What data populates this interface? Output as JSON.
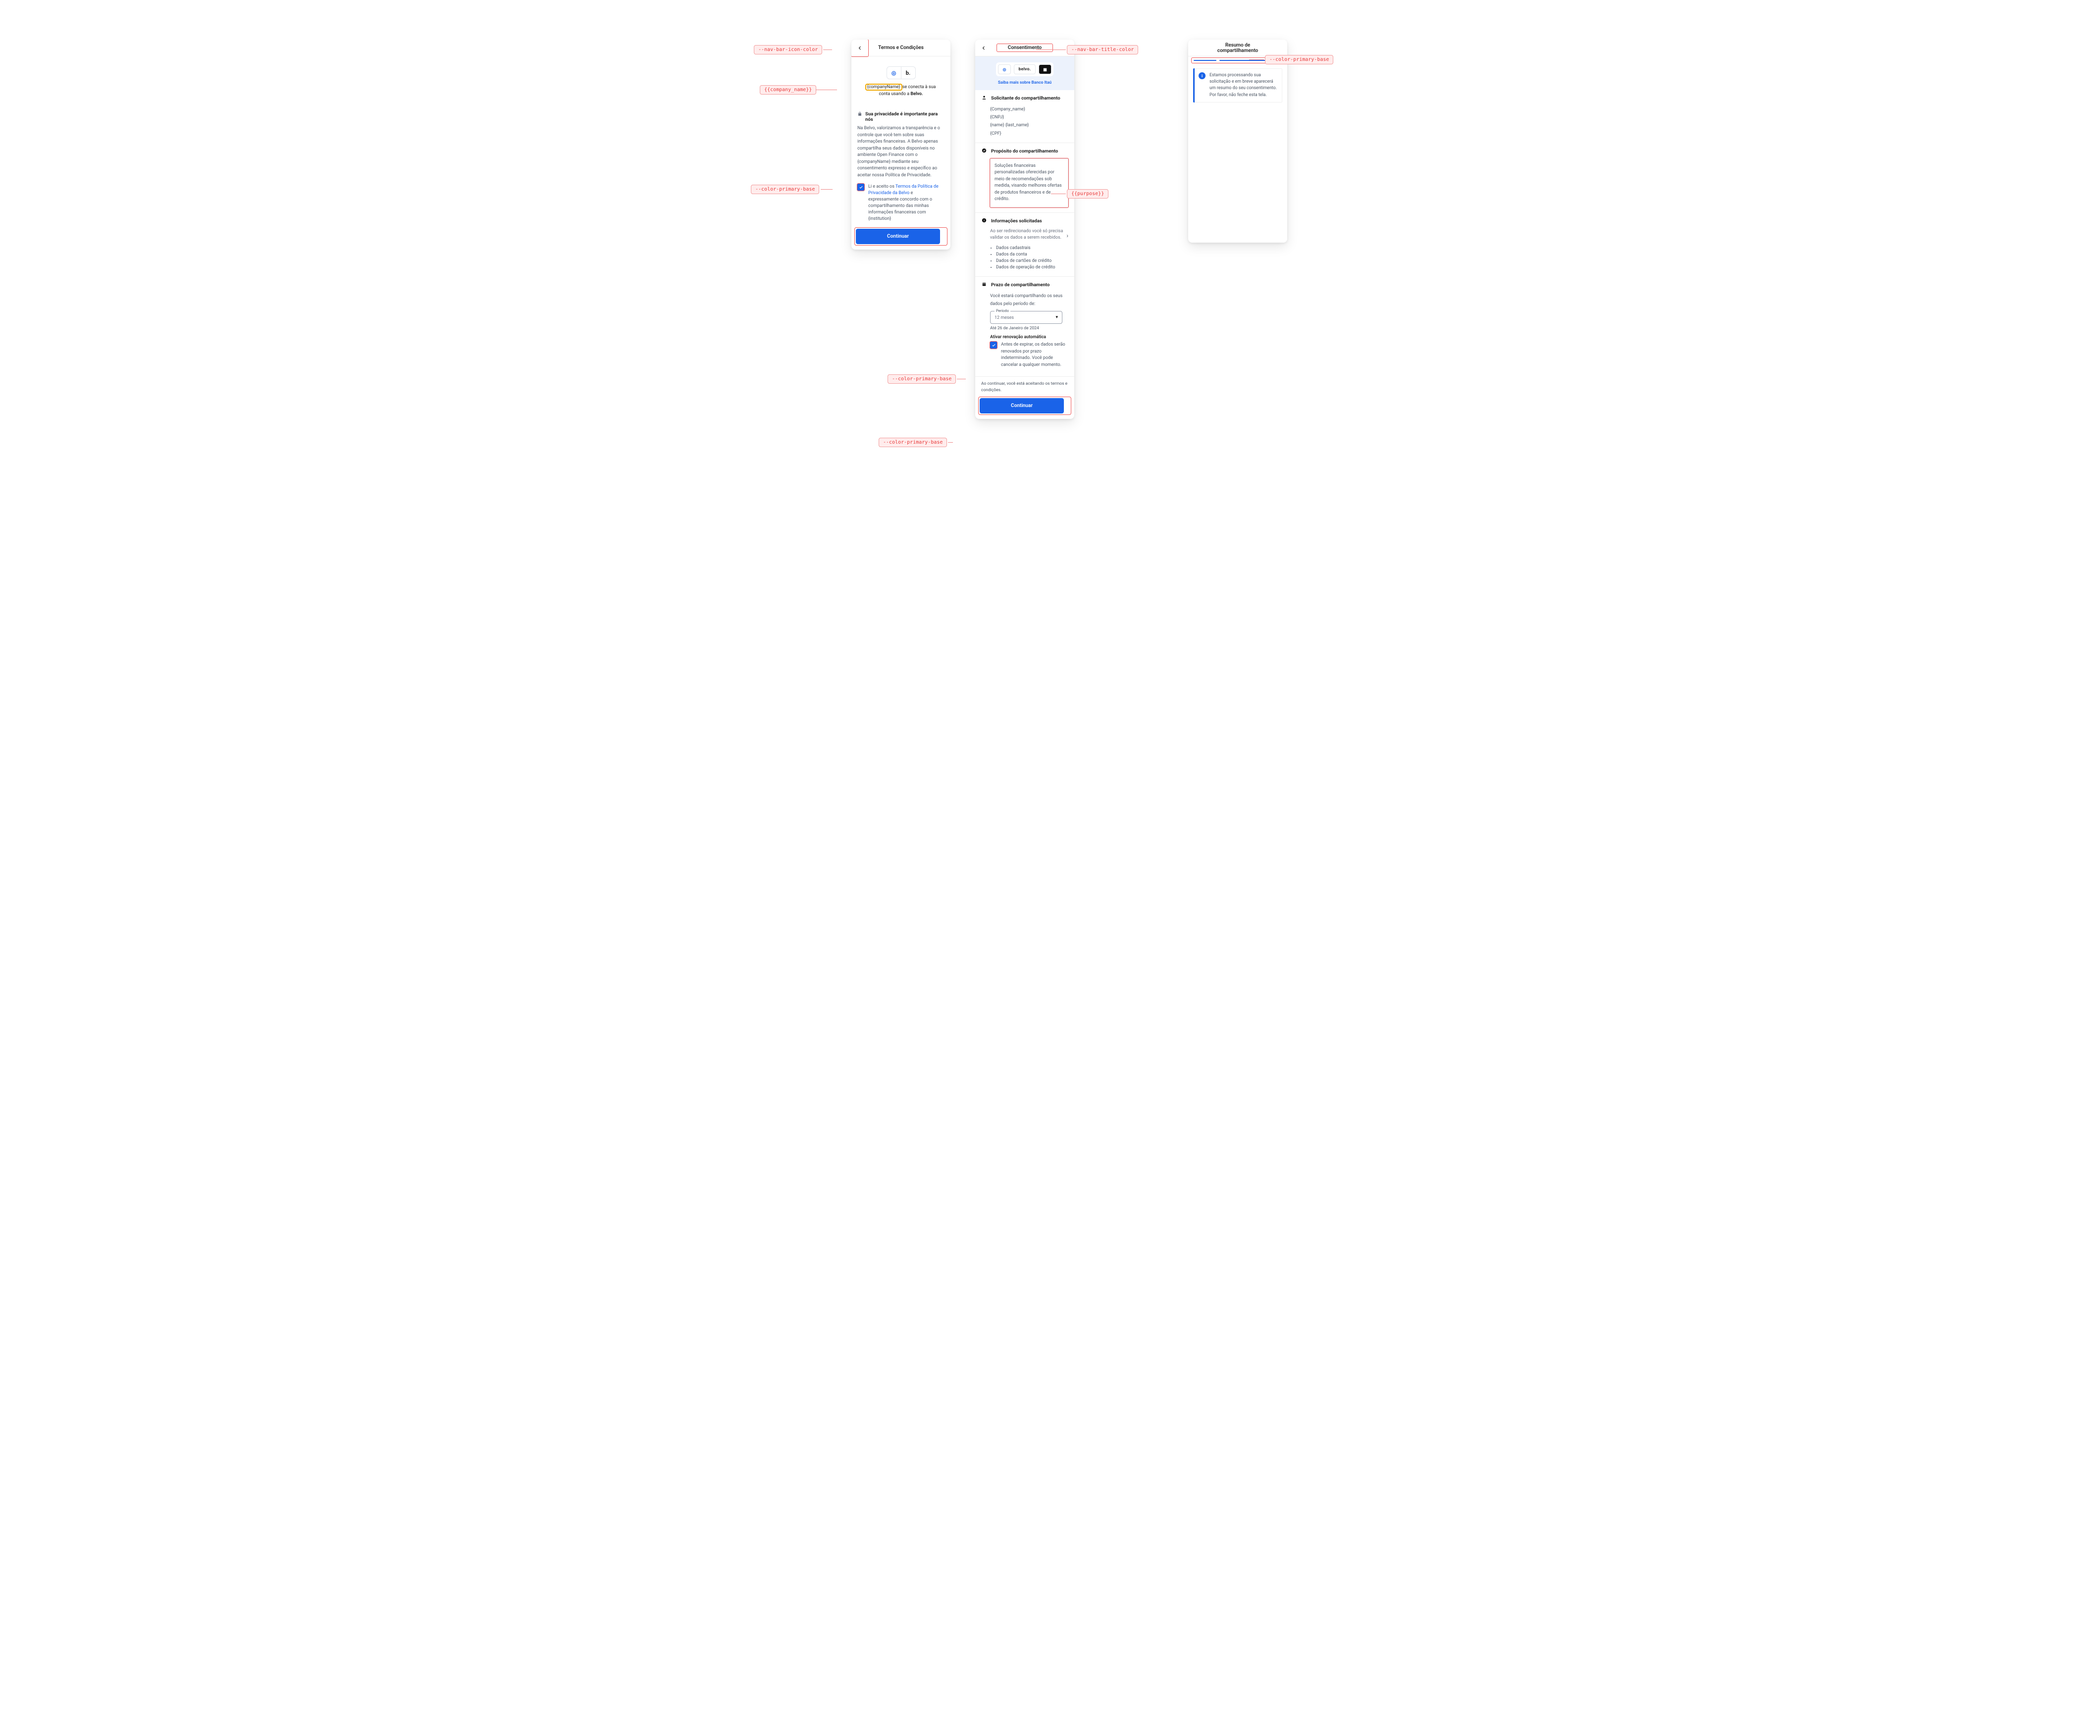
{
  "callouts": {
    "nav_bar_icon_color": "--nav-bar-icon-color",
    "company_name": "{{company_name}}",
    "color_primary_base": "--color-primary-base",
    "nav_bar_title_color": "--nav-bar-title-color",
    "purpose": "{{purpose}}",
    "color_primary_base_2": "--color-primary-base",
    "color_primary_base_3": "--color-primary-base",
    "color_primary_base_4": "--color-primary-base"
  },
  "screen1": {
    "title": "Termos e Condições",
    "intro_company": "{companyName}",
    "intro_rest": " se conecta à sua conta usando a ",
    "intro_brand": "Belvo.",
    "privacy_heading": "Sua privacidade é importante para nós",
    "privacy_body": "Na Belvo, valorizamos a transparência e o controle que você tem sobre suas informações financeiras. A Belvo apenas compartilha seus dados disponíveis no ambiente Open Finance com o {companyName} mediante seu consentimento expresso e específico ao aceitar nossa Política de Privacidade.",
    "consent_prefix": "Li e aceito os ",
    "consent_link": "Termos da Política de Privacidade da Belvo",
    "consent_suffix": " e expressamente concordo com o compartilhamento das minhas informações financeiras com {institution}",
    "button": "Continuar"
  },
  "screen2": {
    "title": "Consentimento",
    "hero_link": "Saiba mais sobre Banco Itaú",
    "sections": {
      "requester": {
        "heading": "Solicitante do compartilhamento",
        "lines": [
          "{Company_name}",
          "{CNPJ}",
          "{name} {last_name}",
          "{CPF}"
        ]
      },
      "purpose": {
        "heading": "Propósito do compartilhamento",
        "text": "Soluções financeiras personalizadas oferecidas por meio de recomendações sob medida, visando melhores ofertas de produtos financeiros e de crédito."
      },
      "info": {
        "heading": "Informações solicitadas",
        "subtext": "Ao ser redirecionado você só precisa validar os dados a serem recebidos.",
        "items": [
          "Dados cadastrais",
          "Dados da conta",
          "Dados de cartões de crédito",
          "Dados de operação de crédito"
        ]
      },
      "term": {
        "heading": "Prazo de compartilhamento",
        "lead": "Você estará compartilhando os seus dados pelo período de:",
        "select_label": "Período",
        "select_value": "12 meses",
        "until": "Até 26 de Janeiro de 2024",
        "renew_heading": "Ativar renovação automática",
        "renew_text": "Antes de expirar, os dados serão renovados por prazo indeterminado. Você pode cancelar a qualquer momento."
      }
    },
    "footer_note": "Ao continuar, você está aceitando os termos e condições.",
    "button": "Continuar"
  },
  "screen3": {
    "title": "Resumo de compartilhamento",
    "alert": "Estamos processando sua solicitação e em breve aparecerá um resumo do seu consentimento. Por favor, não feche esta tela."
  }
}
